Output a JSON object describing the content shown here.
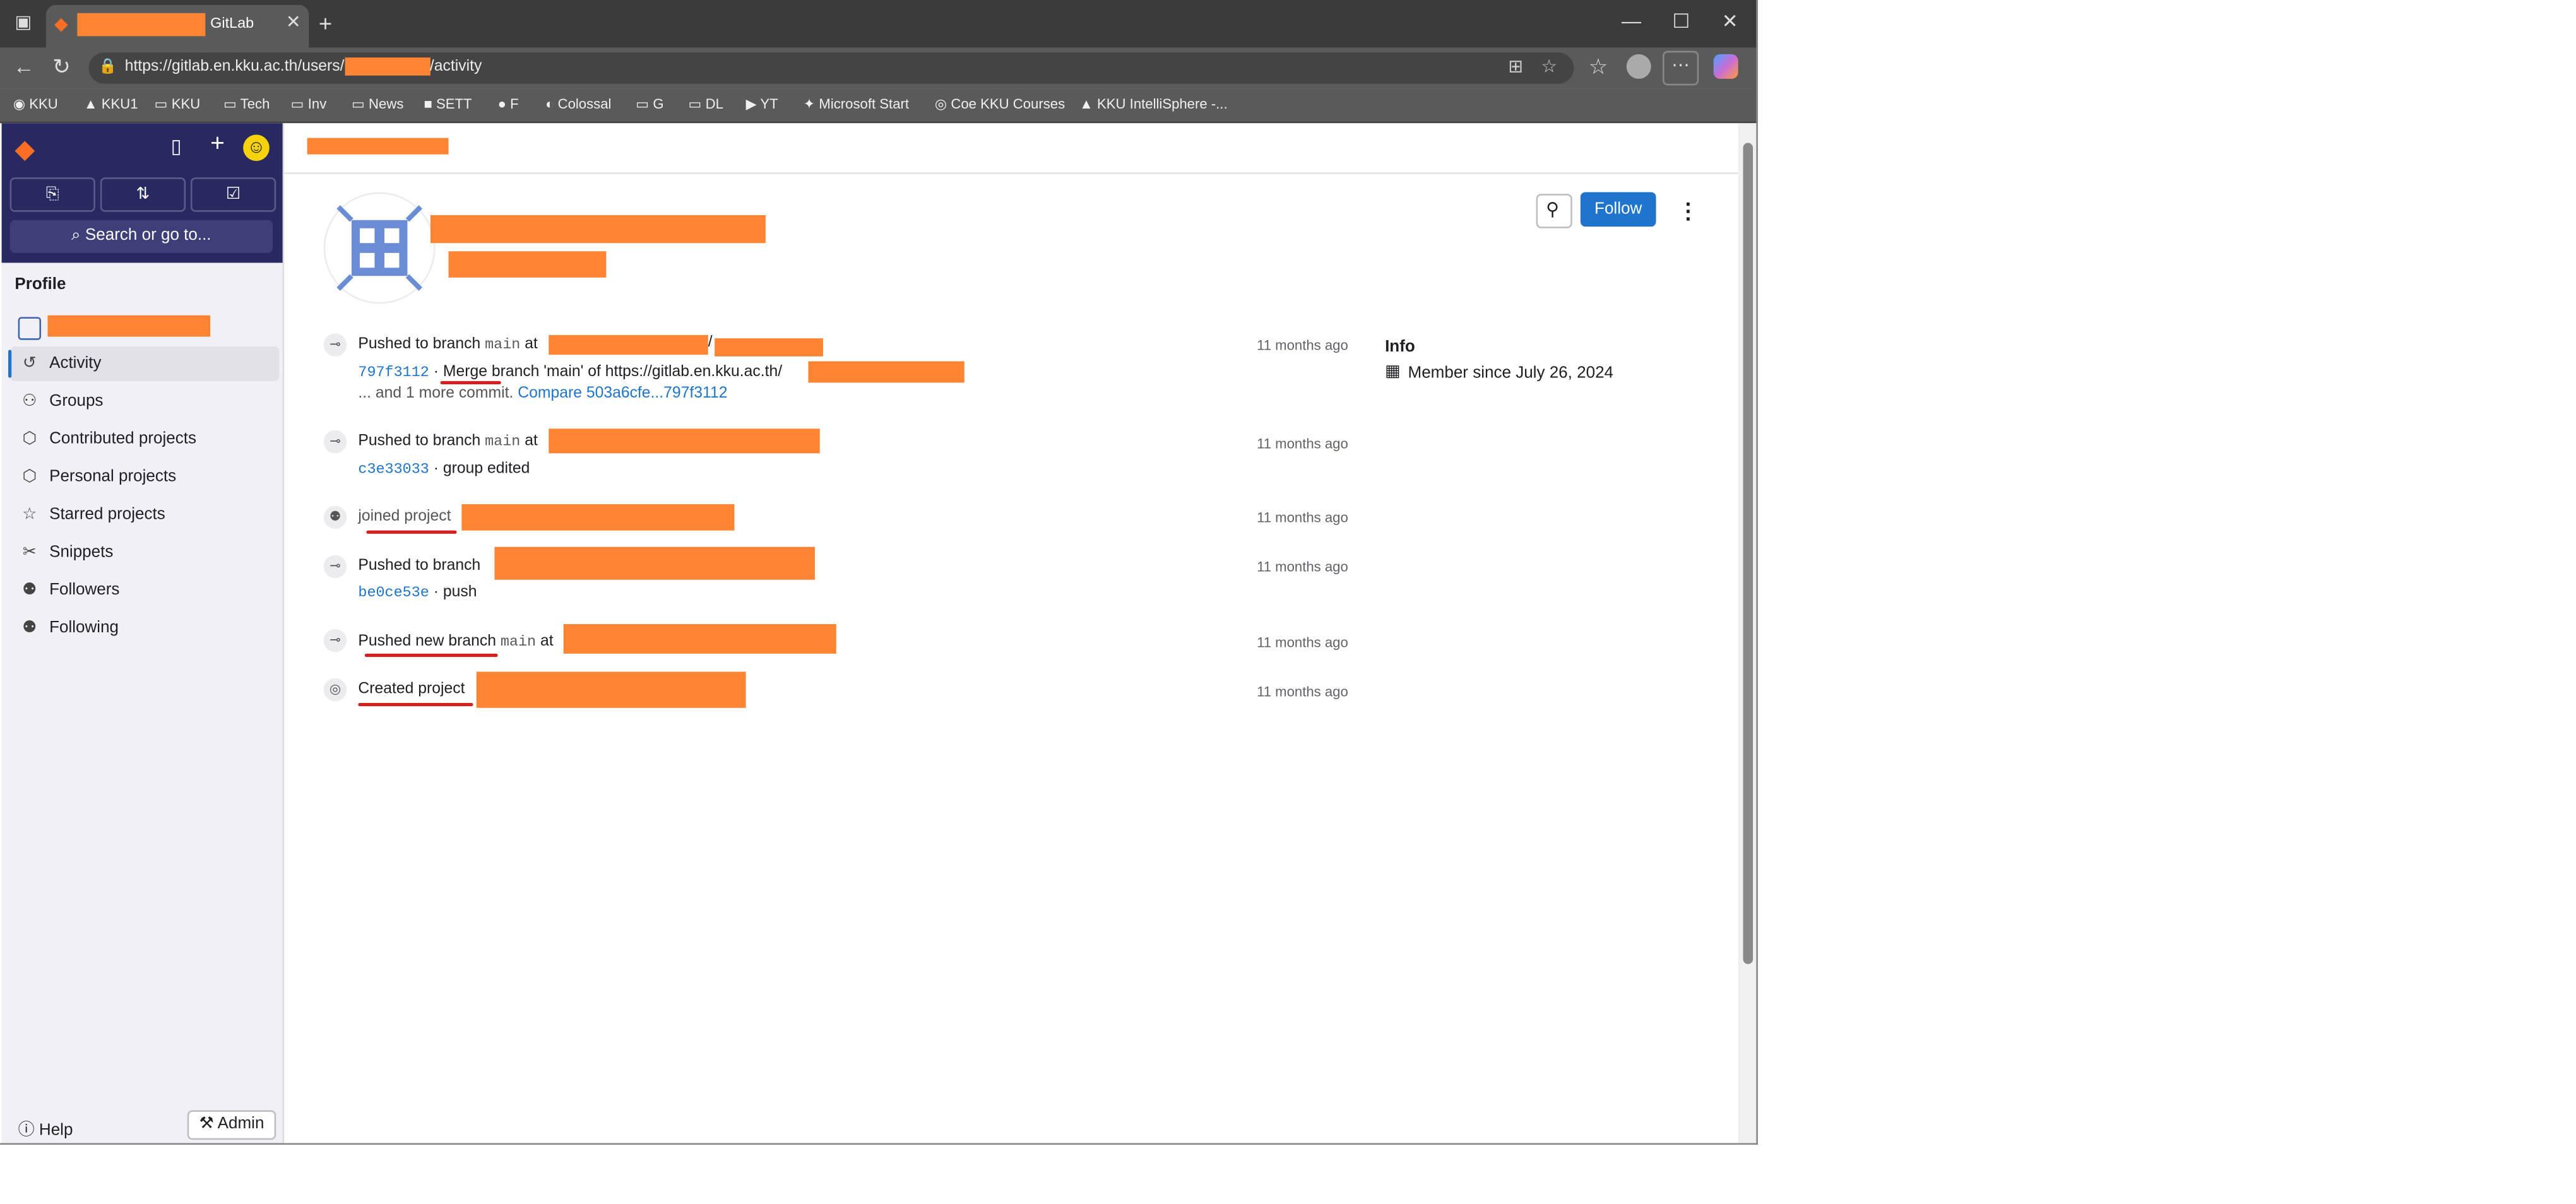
{
  "browser": {
    "tab_title": "GitLab",
    "tab_close": "✕",
    "new_tab": "+",
    "window_controls": [
      "—",
      "☐",
      "✕"
    ],
    "url_prefix": "https://gitlab.en.kku.ac.th/users/",
    "url_suffix": "/activity",
    "bookmarks": [
      "KKU",
      "KKU1",
      "KKU",
      "Tech",
      "Inv",
      "News",
      "SETT",
      "F",
      "Colossal",
      "G",
      "DL",
      "YT",
      "Microsoft Start",
      "Coe KKU Courses",
      "KKU IntelliSphere -..."
    ]
  },
  "sidebar": {
    "search_placeholder": "Search or go to...",
    "section_title": "Profile",
    "nav": [
      {
        "label": "Activity",
        "icon": "history-icon",
        "active": true
      },
      {
        "label": "Groups",
        "icon": "group-icon"
      },
      {
        "label": "Contributed projects",
        "icon": "project-icon"
      },
      {
        "label": "Personal projects",
        "icon": "project-icon"
      },
      {
        "label": "Starred projects",
        "icon": "star-icon"
      },
      {
        "label": "Snippets",
        "icon": "snippet-icon"
      },
      {
        "label": "Followers",
        "icon": "users-icon"
      },
      {
        "label": "Following",
        "icon": "users-icon"
      }
    ],
    "help_label": "Help",
    "admin_label": "Admin"
  },
  "profile": {
    "follow_label": "Follow",
    "info_title": "Info",
    "member_since": "Member since July 26, 2024"
  },
  "events": [
    {
      "action": "Pushed to branch",
      "branch": "main",
      "at": "at",
      "commit": "797f3112",
      "message_pre": "·",
      "message": "Merge branch 'main' of https://gitlab.en.kku.ac.th/",
      "more": "... and 1 more commit.",
      "compare": "Compare 503a6cfe...797f3112",
      "time": "11 months ago"
    },
    {
      "action": "Pushed to branch",
      "branch": "main",
      "at": "at",
      "commit": "c3e33033",
      "message": "· group edited",
      "time": "11 months ago"
    },
    {
      "action": "joined project",
      "time": "11 months ago"
    },
    {
      "action": "Pushed to branch",
      "commit": "be0ce53e",
      "message": "· push",
      "time": "11 months ago"
    },
    {
      "action": "Pushed new branch",
      "branch": "main",
      "at": "at",
      "time": "11 months ago"
    },
    {
      "action": "Created project",
      "time": "11 months ago"
    }
  ],
  "colors": {
    "accent": "#1f75cb",
    "sidebar_top": "#292961",
    "redaction": "#fd8433",
    "annotation": "#d51f1f"
  }
}
